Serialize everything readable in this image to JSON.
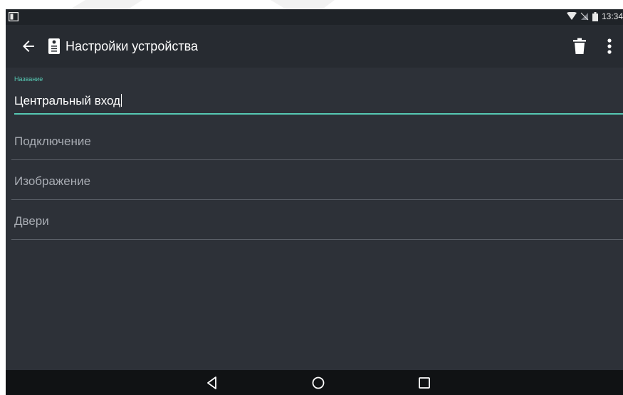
{
  "status_bar": {
    "time": "13:34",
    "icons": [
      "notification-icon",
      "wifi-icon",
      "no-sim-icon",
      "battery-icon"
    ]
  },
  "app_bar": {
    "title": "Настройки устройства",
    "icons": [
      "back-arrow-icon",
      "intercom-device-icon",
      "trash-icon",
      "more-vert-icon"
    ]
  },
  "form": {
    "name_label": "Название",
    "name_value": "Центральный вход"
  },
  "menu": {
    "items": [
      {
        "label": "Подключение"
      },
      {
        "label": "Изображение"
      },
      {
        "label": "Двери"
      }
    ]
  },
  "nav_bar": {
    "icons": [
      "back-triangle-icon",
      "home-circle-icon",
      "recents-square-icon"
    ]
  },
  "colors": {
    "accent": "#56c8b3",
    "background": "#2d3138",
    "app_bar": "#272b31",
    "nav_bar": "#101214"
  }
}
